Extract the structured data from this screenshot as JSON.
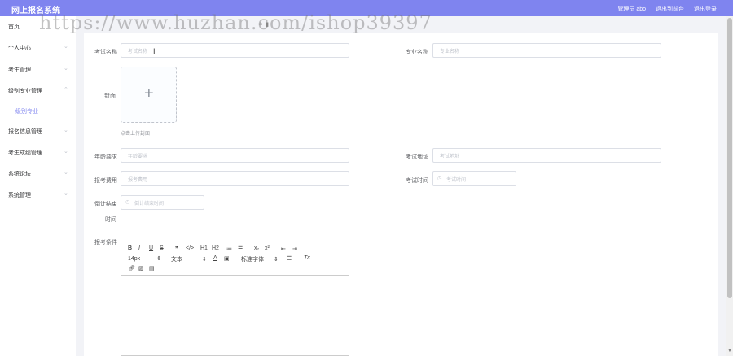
{
  "header": {
    "brand": "网上报名系统",
    "user": "管理员 abo",
    "back_admin": "退出到前台",
    "logout": "退出登录"
  },
  "watermark": "https://www.huzhan.com/ishop39397",
  "sidebar": {
    "items": [
      {
        "label": "首页"
      },
      {
        "label": "个人中心"
      },
      {
        "label": "考生管理"
      },
      {
        "label": "级别专业管理"
      },
      {
        "label": "级别专业"
      },
      {
        "label": "报名信息管理"
      },
      {
        "label": "考生成绩管理"
      },
      {
        "label": "系统论坛"
      },
      {
        "label": "系统管理"
      }
    ]
  },
  "form": {
    "exam_name": {
      "label": "考试名称",
      "placeholder": "考试名称"
    },
    "major_name": {
      "label": "专业名称",
      "placeholder": "专业名称"
    },
    "cover": {
      "label": "封面",
      "hint": "点击上传封面"
    },
    "age": {
      "label": "年龄要求",
      "placeholder": "年龄要求"
    },
    "address": {
      "label": "考试地址",
      "placeholder": "考试地址"
    },
    "fee": {
      "label": "报考费用",
      "placeholder": "报考费用"
    },
    "exam_time": {
      "label": "考试时间",
      "placeholder": "考试时间"
    },
    "countdown": {
      "label_line1": "倒计结束",
      "label_line2": "时间",
      "placeholder": "倒计结束时间"
    },
    "conditions": {
      "label": "报考条件"
    }
  },
  "editor": {
    "row1": [
      "B",
      "I",
      "U",
      "S",
      "❞",
      "</>",
      "H1",
      "H2",
      "≔",
      "☰",
      "x₂",
      "x²",
      "⇤",
      "⇥"
    ],
    "font_size": "14px",
    "text_type": "文本",
    "font_family": "标准字体",
    "clear": "Tx"
  }
}
